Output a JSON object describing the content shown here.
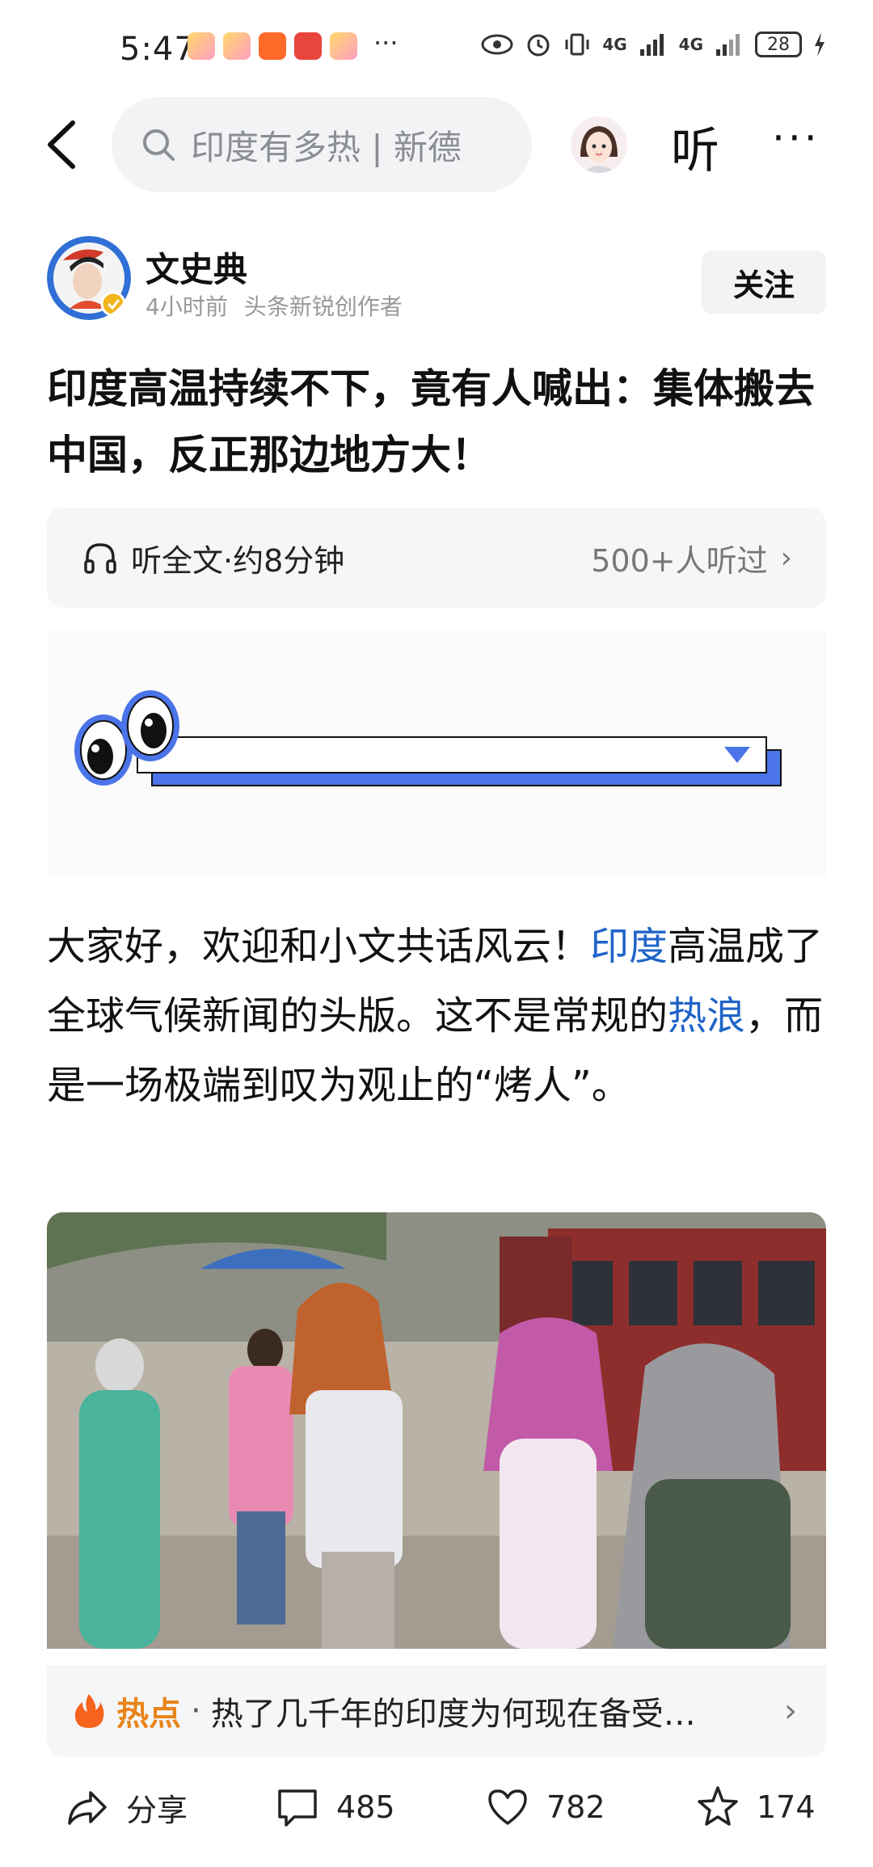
{
  "status_bar": {
    "time": "5:47",
    "overflow": "···",
    "network": [
      "4G",
      "4G"
    ],
    "battery": "28"
  },
  "nav": {
    "search_text": "印度有多热 | 新德",
    "listen_label": "听",
    "more_label": "···"
  },
  "author": {
    "name": "文史典",
    "time": "4小时前",
    "tag": "头条新锐创作者",
    "follow_label": "关注"
  },
  "article": {
    "title": "印度高温持续不下，竟有人喊出：集体搬去中国，反正那边地方大！",
    "listen_full": "听全文·约8分钟",
    "listen_count": "500+人听过",
    "paragraph": {
      "p1": "大家好，欢迎和小文共话风云！",
      "link1": "印度",
      "p2": "高温成了全球气候新闻的头版。这不是常规的",
      "link2": "热浪",
      "p3": "，而是一场极端到叹为观止的“烤人”。"
    }
  },
  "hot": {
    "label": "热点",
    "dot": "·",
    "text": "热了几千年的印度为何现在备受…"
  },
  "actions": {
    "share": "分享",
    "comments": "485",
    "likes": "782",
    "favorites": "174"
  },
  "icons": {
    "back": "back-arrow-icon",
    "search": "search-icon",
    "headphone": "headphone-icon",
    "flame": "flame-icon",
    "share": "share-icon",
    "comment": "comment-icon",
    "like": "heart-icon",
    "favorite": "star-icon"
  },
  "colors": {
    "link": "#1f64c8",
    "hot": "#e9841a",
    "banner_blue": "#4a74e8"
  }
}
